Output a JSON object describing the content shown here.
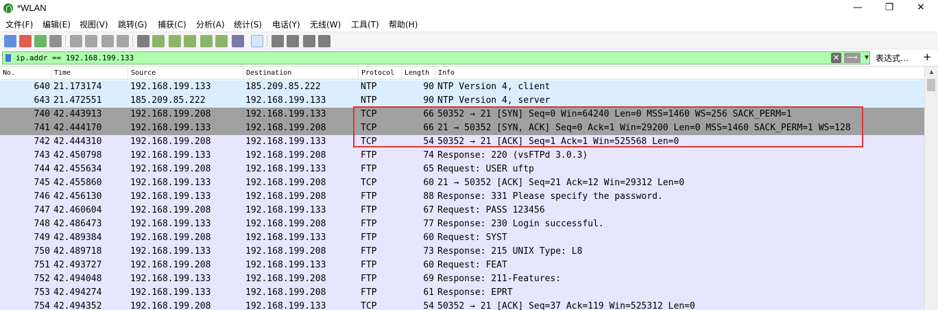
{
  "window": {
    "title": "*WLAN",
    "minimize": "—",
    "maximize": "❐",
    "close": "✕"
  },
  "menu": [
    "文件(F)",
    "编辑(E)",
    "视图(V)",
    "跳转(G)",
    "捕获(C)",
    "分析(A)",
    "统计(S)",
    "电话(Y)",
    "无线(W)",
    "工具(T)",
    "帮助(H)"
  ],
  "toolbar_icons": [
    {
      "name": "shark-fin-start-icon",
      "color": "#2a6fd8"
    },
    {
      "name": "stop-capture-icon",
      "color": "#d9281c"
    },
    {
      "name": "restart-capture-icon",
      "color": "#3aa03a"
    },
    {
      "name": "capture-options-icon",
      "color": "#6f6f6f"
    },
    {
      "name": "open-file-icon",
      "color": "#8a8a8a"
    },
    {
      "name": "save-file-icon",
      "color": "#8a8a8a"
    },
    {
      "name": "close-file-icon",
      "color": "#8a8a8a"
    },
    {
      "name": "reload-file-icon",
      "color": "#8a8a8a"
    },
    {
      "name": "find-packet-icon",
      "color": "#555555"
    },
    {
      "name": "go-back-icon",
      "color": "#6a9f3a"
    },
    {
      "name": "go-forward-icon",
      "color": "#6a9f3a"
    },
    {
      "name": "go-to-packet-icon",
      "color": "#6a9f3a"
    },
    {
      "name": "go-first-icon",
      "color": "#6a9f3a"
    },
    {
      "name": "go-last-icon",
      "color": "#6a9f3a"
    },
    {
      "name": "auto-scroll-icon",
      "color": "#4f4f8f"
    },
    {
      "name": "colorize-icon",
      "color": "#4f4f8f"
    },
    {
      "name": "zoom-in-icon",
      "color": "#555555"
    },
    {
      "name": "zoom-out-icon",
      "color": "#555555"
    },
    {
      "name": "zoom-normal-icon",
      "color": "#555555"
    },
    {
      "name": "resize-columns-icon",
      "color": "#555555"
    }
  ],
  "filter": {
    "value": "ip.addr == 192.168.199.133",
    "clear_symbol": "✕",
    "apply_symbol": "⟶",
    "dropdown_symbol": "▼",
    "expression_label": "表达式…",
    "add_symbol": "+"
  },
  "columns": [
    "No.",
    "Time",
    "Source",
    "Destination",
    "Protocol",
    "Length",
    "Info"
  ],
  "colors": {
    "ntp_row": "#daeeff",
    "tcp_syn_row": "#a0a0a0",
    "default_row": "#e7e6ff",
    "highlight_border": "#e03333",
    "filter_valid": "#afffaf"
  },
  "packets": [
    {
      "no": "640",
      "time": "21.173174",
      "src": "192.168.199.133",
      "dst": "185.209.85.222",
      "proto": "NTP",
      "len": "90",
      "info": "NTP Version 4, client",
      "style": "ntp"
    },
    {
      "no": "643",
      "time": "21.472551",
      "src": "185.209.85.222",
      "dst": "192.168.199.133",
      "proto": "NTP",
      "len": "90",
      "info": "NTP Version 4, server",
      "style": "ntp"
    },
    {
      "no": "740",
      "time": "42.443913",
      "src": "192.168.199.208",
      "dst": "192.168.199.133",
      "proto": "TCP",
      "len": "66",
      "info": "50352 → 21 [SYN] Seq=0 Win=64240 Len=0 MSS=1460 WS=256 SACK_PERM=1",
      "style": "syn"
    },
    {
      "no": "741",
      "time": "42.444170",
      "src": "192.168.199.133",
      "dst": "192.168.199.208",
      "proto": "TCP",
      "len": "66",
      "info": "21 → 50352 [SYN, ACK] Seq=0 Ack=1 Win=29200 Len=0 MSS=1460 SACK_PERM=1 WS=128",
      "style": "syn"
    },
    {
      "no": "742",
      "time": "42.444310",
      "src": "192.168.199.208",
      "dst": "192.168.199.133",
      "proto": "TCP",
      "len": "54",
      "info": "50352 → 21 [ACK] Seq=1 Ack=1 Win=525568 Len=0",
      "style": "default"
    },
    {
      "no": "743",
      "time": "42.450798",
      "src": "192.168.199.133",
      "dst": "192.168.199.208",
      "proto": "FTP",
      "len": "74",
      "info": "Response: 220 (vsFTPd 3.0.3)",
      "style": "default"
    },
    {
      "no": "744",
      "time": "42.455634",
      "src": "192.168.199.208",
      "dst": "192.168.199.133",
      "proto": "FTP",
      "len": "65",
      "info": "Request: USER uftp",
      "style": "default"
    },
    {
      "no": "745",
      "time": "42.455860",
      "src": "192.168.199.133",
      "dst": "192.168.199.208",
      "proto": "TCP",
      "len": "60",
      "info": "21 → 50352 [ACK] Seq=21 Ack=12 Win=29312 Len=0",
      "style": "default"
    },
    {
      "no": "746",
      "time": "42.456130",
      "src": "192.168.199.133",
      "dst": "192.168.199.208",
      "proto": "FTP",
      "len": "88",
      "info": "Response: 331 Please specify the password.",
      "style": "default"
    },
    {
      "no": "747",
      "time": "42.460604",
      "src": "192.168.199.208",
      "dst": "192.168.199.133",
      "proto": "FTP",
      "len": "67",
      "info": "Request: PASS 123456",
      "style": "default"
    },
    {
      "no": "748",
      "time": "42.486473",
      "src": "192.168.199.133",
      "dst": "192.168.199.208",
      "proto": "FTP",
      "len": "77",
      "info": "Response: 230 Login successful.",
      "style": "default"
    },
    {
      "no": "749",
      "time": "42.489384",
      "src": "192.168.199.208",
      "dst": "192.168.199.133",
      "proto": "FTP",
      "len": "60",
      "info": "Request: SYST",
      "style": "default"
    },
    {
      "no": "750",
      "time": "42.489718",
      "src": "192.168.199.133",
      "dst": "192.168.199.208",
      "proto": "FTP",
      "len": "73",
      "info": "Response: 215 UNIX Type: L8",
      "style": "default"
    },
    {
      "no": "751",
      "time": "42.493727",
      "src": "192.168.199.208",
      "dst": "192.168.199.133",
      "proto": "FTP",
      "len": "60",
      "info": "Request: FEAT",
      "style": "default"
    },
    {
      "no": "752",
      "time": "42.494048",
      "src": "192.168.199.133",
      "dst": "192.168.199.208",
      "proto": "FTP",
      "len": "69",
      "info": "Response: 211-Features:",
      "style": "default"
    },
    {
      "no": "753",
      "time": "42.494274",
      "src": "192.168.199.133",
      "dst": "192.168.199.208",
      "proto": "FTP",
      "len": "61",
      "info": "Response:  EPRT",
      "style": "default"
    },
    {
      "no": "754",
      "time": "42.494352",
      "src": "192.168.199.208",
      "dst": "192.168.199.133",
      "proto": "TCP",
      "len": "54",
      "info": "50352 → 21 [ACK] Seq=37 Ack=119 Win=525312 Len=0",
      "style": "default"
    }
  ],
  "scrollbar": {
    "up_symbol": "▲"
  }
}
